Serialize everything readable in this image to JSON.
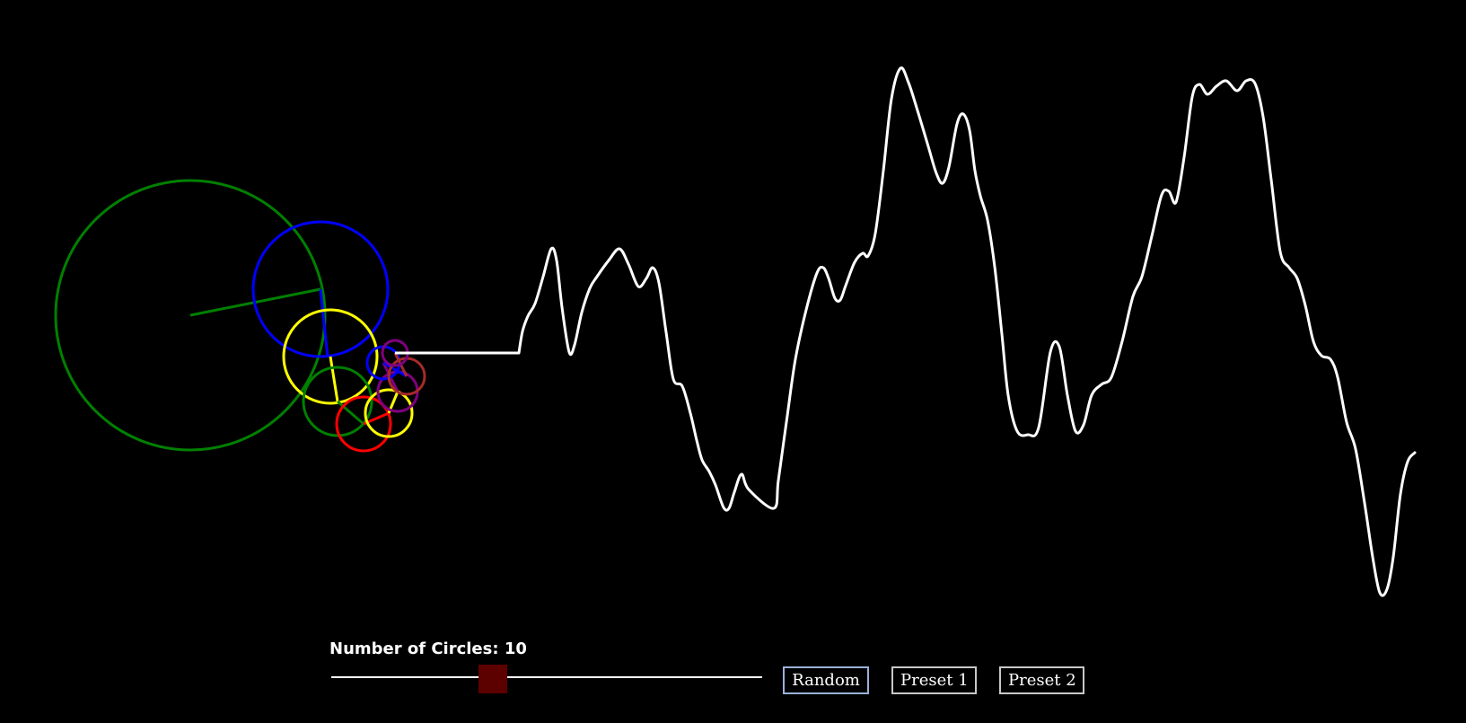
{
  "controls": {
    "circles_label": "Number of Circles: 10",
    "circle_count": 10,
    "slider_min": 1,
    "slider_max": 25,
    "buttons": {
      "random": "Random",
      "preset1": "Preset 1",
      "preset2": "Preset 2"
    }
  },
  "colors": {
    "background": "#000000",
    "wave": "#ffffff",
    "slider_thumb": "#5c0000",
    "slider_track": "#ffffff",
    "circle_palette": [
      "#008000",
      "#0000ff",
      "#ffff00",
      "#008000",
      "#ff0000",
      "#ffff00",
      "#800080",
      "#0000ff",
      "#a52a2a",
      "#800080"
    ]
  }
}
